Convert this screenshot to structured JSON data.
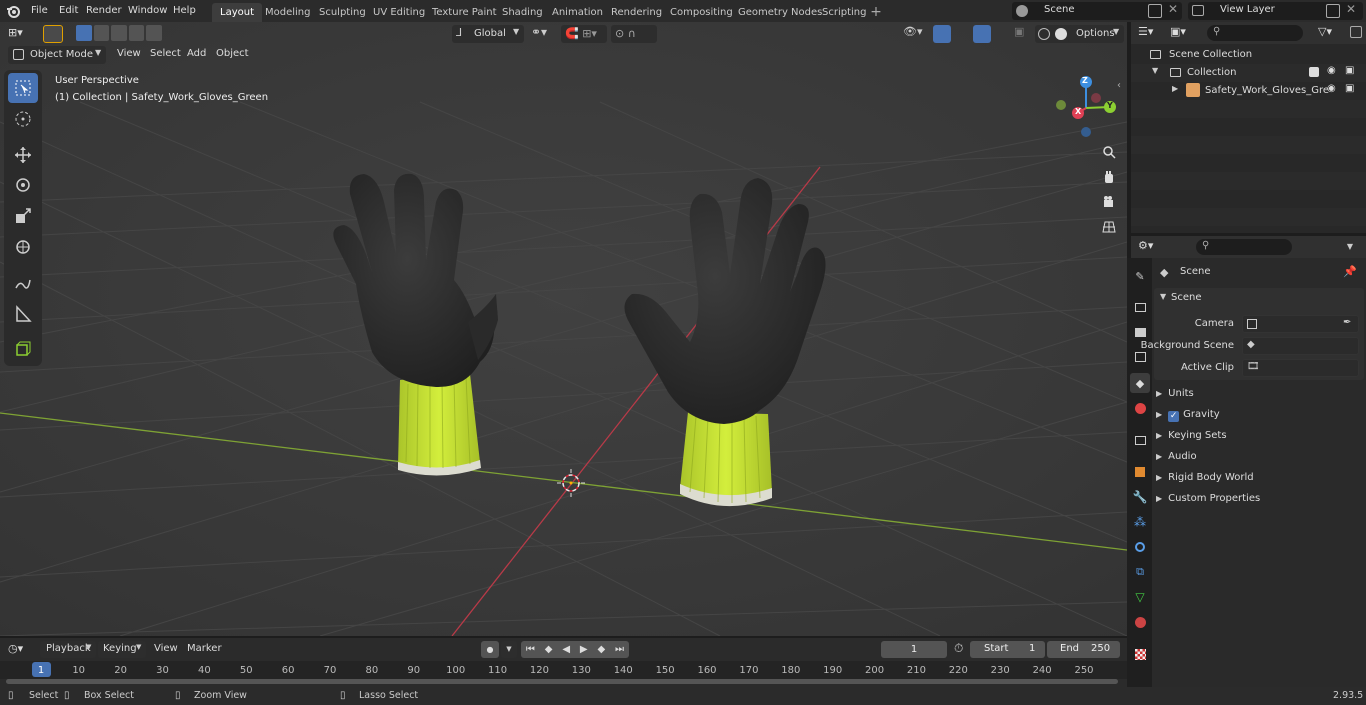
{
  "menubar": {
    "file": "File",
    "edit": "Edit",
    "render": "Render",
    "window": "Window",
    "help": "Help"
  },
  "workspaces": [
    "Layout",
    "Modeling",
    "Sculpting",
    "UV Editing",
    "Texture Paint",
    "Shading",
    "Animation",
    "Rendering",
    "Compositing",
    "Geometry Nodes",
    "Scripting"
  ],
  "active_workspace": "Layout",
  "scene": {
    "label": "Scene",
    "view_layer": "View Layer"
  },
  "viewport_header": {
    "mode": "Object Mode",
    "view": "View",
    "select": "Select",
    "add": "Add",
    "object": "Object",
    "orientation": "Global",
    "options": "Options"
  },
  "viewport": {
    "perspective": "User Perspective",
    "collection_info": "(1) Collection | Safety_Work_Gloves_Green"
  },
  "gizmo": {
    "x": "X",
    "y": "Y",
    "z": "Z"
  },
  "outliner": {
    "root": "Scene Collection",
    "collection": "Collection",
    "object": "Safety_Work_Gloves_Gre"
  },
  "properties": {
    "context": "Scene",
    "panel": "Scene",
    "camera_label": "Camera",
    "bg_scene_label": "Background Scene",
    "active_clip_label": "Active Clip",
    "sections": [
      "Units",
      "Gravity",
      "Keying Sets",
      "Audio",
      "Rigid Body World",
      "Custom Properties"
    ]
  },
  "timeline": {
    "playback": "Playback",
    "keying": "Keying",
    "view": "View",
    "marker": "Marker",
    "current_frame": "1",
    "start_label": "Start",
    "start": "1",
    "end_label": "End",
    "end": "250",
    "ticks": [
      "1",
      "10",
      "20",
      "30",
      "40",
      "50",
      "60",
      "70",
      "80",
      "90",
      "100",
      "110",
      "120",
      "130",
      "140",
      "150",
      "160",
      "170",
      "180",
      "190",
      "200",
      "210",
      "220",
      "230",
      "240",
      "250"
    ]
  },
  "statusbar": {
    "select": "Select",
    "box_select": "Box Select",
    "zoom_view": "Zoom View",
    "lasso_select": "Lasso Select",
    "version": "2.93.5"
  },
  "colors": {
    "accent": "#4772b3",
    "x_axis": "#e04055",
    "y_axis": "#8ccf32",
    "z_axis": "#3d8fe0",
    "glove_cuff": "#c8e632"
  }
}
